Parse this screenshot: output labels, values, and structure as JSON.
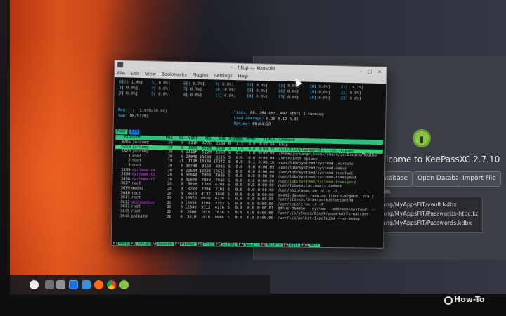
{
  "konsole": {
    "title": "~ : htop — Konsole",
    "controls": "– □ ×",
    "menu": [
      "File",
      "Edit",
      "View",
      "Bookmarks",
      "Plugins",
      "Settings",
      "Help"
    ]
  },
  "htop": {
    "cpus": [
      {
        "n": "0",
        "bar": "||",
        "pct": "1.4%"
      },
      {
        "n": "1",
        "bar": "",
        "pct": "0.0%"
      },
      {
        "n": "2",
        "bar": "",
        "pct": "0.0%"
      },
      {
        "n": "3",
        "bar": "",
        "pct": "0.0%"
      },
      {
        "n": "4",
        "bar": "",
        "pct": "0.0%"
      },
      {
        "n": "5",
        "bar": "",
        "pct": "0.0%"
      },
      {
        "n": "6",
        "bar": "|",
        "pct": "0.7%"
      },
      {
        "n": "7",
        "bar": "",
        "pct": "0.7%"
      },
      {
        "n": "8",
        "bar": "",
        "pct": "0.0%"
      },
      {
        "n": "9",
        "bar": "",
        "pct": "0.0%"
      },
      {
        "n": "10",
        "bar": "",
        "pct": "0.0%"
      },
      {
        "n": "11",
        "bar": "",
        "pct": "0.0%"
      },
      {
        "n": "12",
        "bar": "",
        "pct": "0.0%"
      },
      {
        "n": "13",
        "bar": "",
        "pct": "0.0%"
      },
      {
        "n": "14",
        "bar": "",
        "pct": "0.0%"
      },
      {
        "n": "15",
        "bar": "",
        "pct": "0.0%"
      },
      {
        "n": "16",
        "bar": "",
        "pct": "0.0%"
      },
      {
        "n": "17",
        "bar": "",
        "pct": "0.0%"
      },
      {
        "n": "18",
        "bar": "",
        "pct": "0.0%"
      },
      {
        "n": "19",
        "bar": "",
        "pct": "0.0%"
      },
      {
        "n": "20",
        "bar": "",
        "pct": "0.0%"
      },
      {
        "n": "21",
        "bar": "|",
        "pct": "0.7%"
      },
      {
        "n": "22",
        "bar": "",
        "pct": "0.0%"
      },
      {
        "n": "23",
        "bar": "",
        "pct": "0.0%"
      }
    ],
    "mem_label": "Mem",
    "mem_value": "1.97G/30.8G",
    "swp_label": "Swp",
    "swp_value": "0K/512M",
    "tasks_label": "Tasks:",
    "tasks_value": "86, 264 thr, 407 kthr; 1 running",
    "load_label": "Load average:",
    "load_value": "0.10 0.12 0.05",
    "uptime_label": "Uptime:",
    "uptime_value": "00:04:20",
    "tabs": [
      "Main",
      "I/O"
    ],
    "header": [
      "PID",
      "USER",
      "PRI",
      "NI",
      "VIRT",
      "RES",
      "SHR",
      "S",
      "CPU%",
      "MEM%",
      "TIME+",
      "Command"
    ],
    "processes": [
      {
        "pid": "4285",
        "user": "jordang",
        "pri": "20",
        "ni": "0",
        "virt": "331M",
        "res": "4776",
        "shr": "3584",
        "s": "R",
        "cpu": "1.3",
        "mem": "0.0",
        "time": "0:03.04",
        "cmd": "htop"
      },
      {
        "pid": "6228",
        "user": "jordang",
        "pri": "20",
        "ni": "0",
        "virt": "1600",
        "res": "5228",
        "shr": "3692",
        "s": "S",
        "cpu": "1.3",
        "mem": "0.0",
        "time": "0:00.35",
        "cmd": "/usr/bin/plasmashell --no-respawn"
      },
      {
        "pid": "5528",
        "user": "jordang",
        "pri": "20",
        "ni": "0",
        "virt": "2110M",
        "res": "512M",
        "shr": "106M",
        "s": "S",
        "cpu": "0.7",
        "mem": "1.6",
        "time": "0:00.09",
        "cmd": "/home/jordang/.local/share/JetBrains/Toolbo"
      },
      {
        "pid": "1",
        "user": "root",
        "pri": "20",
        "ni": "0",
        "virt": "23048",
        "res": "13540",
        "shr": "9516",
        "s": "S",
        "cpu": "0.0",
        "mem": "0.0",
        "time": "0:00.89",
        "cmd": "/sbin/init splash"
      },
      {
        "pid": "2",
        "user": "root",
        "pri": "19",
        "ni": "-1",
        "virt": "113M",
        "res": "10140",
        "shr": "17372",
        "s": "S",
        "cpu": "0.0",
        "mem": "0.1",
        "time": "0:00.16",
        "cmd": "/usr/lib/systemd/systemd-journald"
      },
      {
        "pid": "3",
        "user": "root",
        "pri": "20",
        "ni": "0",
        "virt": "30748",
        "res": "8160",
        "shr": "4096",
        "s": "S",
        "cpu": "0.0",
        "mem": "0.0",
        "time": "0:00.09",
        "cmd": "/usr/lib/systemd/systemd-udevd"
      },
      {
        "pid": "3389",
        "user": "systemd-re",
        "pri": "20",
        "ni": "0",
        "virt": "21584",
        "res": "12536",
        "shr": "10616",
        "s": "S",
        "cpu": "0.0",
        "mem": "0.0",
        "time": "0:00.04",
        "cmd": "/usr/lib/systemd/systemd-resolved"
      },
      {
        "pid": "3390",
        "user": "systemd-ti",
        "pri": "20",
        "ni": "0",
        "virt": "91040",
        "res": "7800",
        "shr": "7040",
        "s": "S",
        "cpu": "0.0",
        "mem": "0.0",
        "time": "0:00.00",
        "cmd": "/usr/lib/systemd/systemd-timesyncd"
      },
      {
        "pid": "3436",
        "user": "systemd-ti",
        "pri": "20",
        "ni": "0",
        "virt": "91040",
        "res": "7800",
        "shr": "7040",
        "s": "S",
        "cpu": "0.0",
        "mem": "0.0",
        "time": "0:00.00",
        "cmd": "/usr/lib/systemd/systemd-timesyncd"
      },
      {
        "pid": "3637",
        "user": "root",
        "pri": "20",
        "ni": "0",
        "virt": "305M",
        "res": "7200",
        "shr": "6704",
        "s": "S",
        "cpu": "0.0",
        "mem": "0.0",
        "time": "0:00.00",
        "cmd": "/usr/libexec/accounts-daemon"
      },
      {
        "pid": "3639",
        "user": "avahi",
        "pri": "20",
        "ni": "0",
        "virt": "8280",
        "res": "2304",
        "shr": "2192",
        "s": "S",
        "cpu": "0.0",
        "mem": "0.0",
        "time": "0:00.00",
        "cmd": "/usr/sbin/anacron -d -q -s"
      },
      {
        "pid": "3640",
        "user": "root",
        "pri": "20",
        "ni": "0",
        "virt": "8620",
        "res": "4132",
        "shr": "3948",
        "s": "S",
        "cpu": "0.0",
        "mem": "0.0",
        "time": "0:00.00",
        "cmd": "avahi-daemon: running [focus-m2gen6.local]"
      },
      {
        "pid": "3641",
        "user": "root",
        "pri": "20",
        "ni": "0",
        "virt": "13676",
        "res": "6620",
        "shr": "6236",
        "s": "S",
        "cpu": "0.0",
        "mem": "0.0",
        "time": "0:00.00",
        "cmd": "/usr/libexec/bluetooth/bluetoothd"
      },
      {
        "pid": "3642",
        "user": "messagebus",
        "pri": "20",
        "ni": "0",
        "virt": "13036",
        "res": "3504",
        "shr": "3392",
        "s": "S",
        "cpu": "0.0",
        "mem": "0.0",
        "time": "0:00.00",
        "cmd": "/usr/sbin/cron -f -P"
      },
      {
        "pid": "3643",
        "user": "root",
        "pri": "20",
        "ni": "0",
        "virt": "12340",
        "res": "5712",
        "shr": "4176",
        "s": "S",
        "cpu": "0.0",
        "mem": "0.0",
        "time": "0:00.01",
        "cmd": "@dbus-daemon --system --address=systemd: --"
      },
      {
        "pid": "3645",
        "user": "root",
        "pri": "20",
        "ni": "0",
        "virt": "2600",
        "res": "1016",
        "shr": "1016",
        "s": "S",
        "cpu": "0.0",
        "mem": "0.0",
        "time": "0:00.00",
        "cmd": "/usr/lib/kfocus/bin/kfocus-btrfs-watcher"
      },
      {
        "pid": "3646",
        "user": "polkitd",
        "pri": "20",
        "ni": "0",
        "virt": "301M",
        "res": "1016",
        "shr": "9088",
        "s": "S",
        "cpu": "0.0",
        "mem": "0.0",
        "time": "0:00.00",
        "cmd": "/usr/lib/polkit-1/polkitd --no-debug"
      }
    ],
    "fkeys": [
      {
        "k": "F1",
        "l": "Help"
      },
      {
        "k": "F2",
        "l": "Setup"
      },
      {
        "k": "F3",
        "l": "Search"
      },
      {
        "k": "F4",
        "l": "Filter"
      },
      {
        "k": "F5",
        "l": "Tree"
      },
      {
        "k": "F6",
        "l": "SortBy"
      },
      {
        "k": "F7",
        "l": "Nice -"
      },
      {
        "k": "F8",
        "l": "Nice +"
      },
      {
        "k": "F9",
        "l": "Kill"
      },
      {
        "k": "F10",
        "l": "Quit"
      }
    ]
  },
  "keepass": {
    "welcome": "lcome to KeePassXC 2.7.10",
    "btn_db": "atabase",
    "btn_open": "Open Database",
    "btn_import": "Import File",
    "recent_label": "ases",
    "recent": [
      "ang/MyAppsFIT/vault.kdbx",
      "ang/MyAppsFIT/Passwords-htpc.kdbx",
      "ang/MyAppsFIT/Passwords.kdbx"
    ]
  },
  "watermark": "How-To"
}
